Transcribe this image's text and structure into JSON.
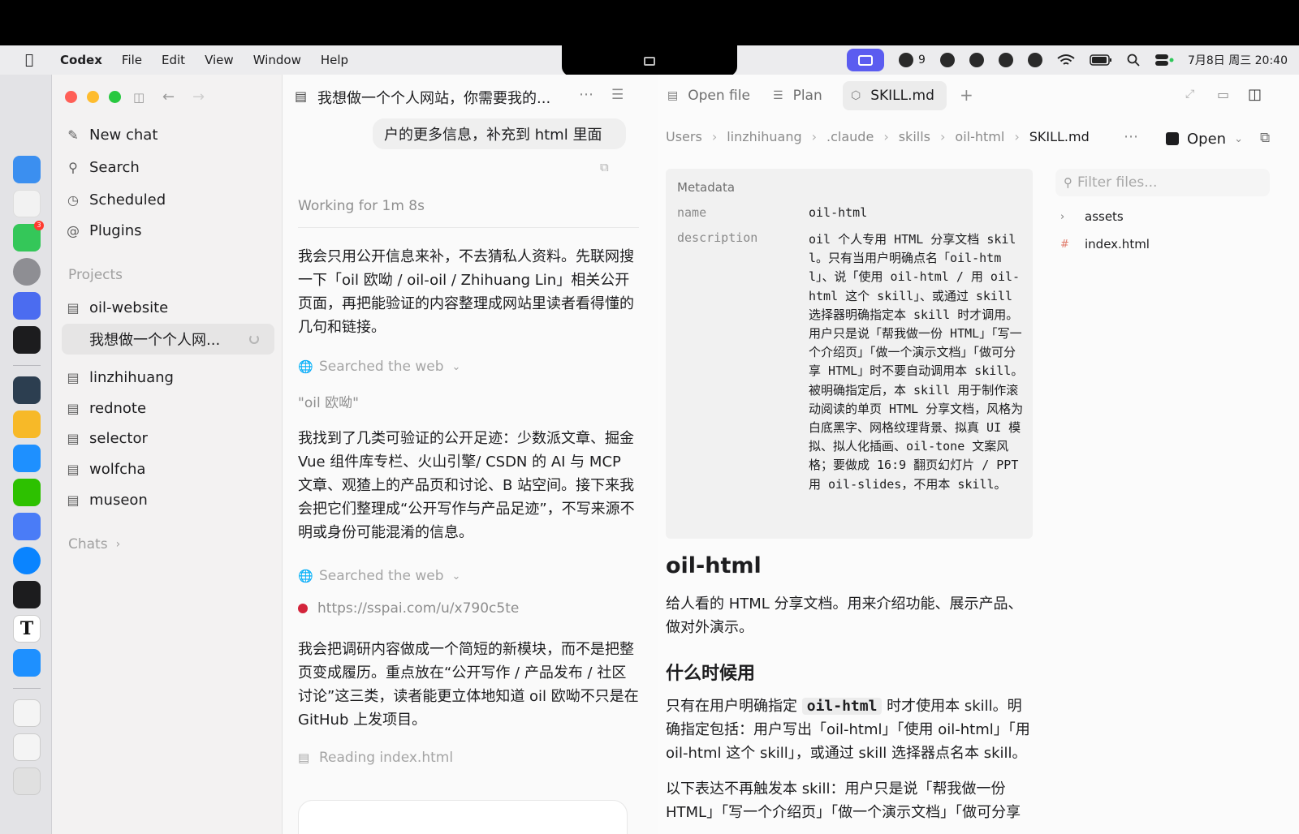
{
  "menubar": {
    "app": "Codex",
    "menus": [
      "File",
      "Edit",
      "View",
      "Window",
      "Help"
    ],
    "wechat_count": "9",
    "clock": "7月8日 周三 20:40"
  },
  "sidebar": {
    "new_chat": "New chat",
    "search": "Search",
    "scheduled": "Scheduled",
    "plugins": "Plugins",
    "projects_heading": "Projects",
    "project_main": "oil-website",
    "active_thread": "我想做一个个人网...",
    "projects": [
      "linzhihuang",
      "rednote",
      "selector",
      "wolfcha",
      "museon"
    ],
    "chats_heading": "Chats"
  },
  "chat": {
    "title": "我想做一个个人网站，你需要我的...",
    "bubble": "户的更多信息，补充到 html 里面",
    "working": "Working for 1m 8s",
    "para1": "我会只用公开信息来补，不去猜私人资料。先联网搜一下「oil 欧呦 / oil-oil / Zhihuang Lin」相关公开页面，再把能验证的内容整理成网站里读者看得懂的几句和链接。",
    "searched1": "Searched the web",
    "query1": "\"oil 欧呦\"",
    "para2": "我找到了几类可验证的公开足迹：少数派文章、掘金 Vue 组件库专栏、火山引擎/ CSDN 的 AI 与 MCP 文章、观猹上的产品页和讨论、B 站空间。接下来我会把它们整理成“公开写作与产品足迹”，不写来源不明或身份可能混淆的信息。",
    "searched2": "Searched the web",
    "link": "https://sspai.com/u/x790c5te",
    "para3": "我会把调研内容做成一个简短的新模块，而不是把整页变成履历。重点放在“公开写作 / 产品发布 / 社区讨论”这三类，读者能更立体地知道 oil 欧呦不只是在 GitHub 上发项目。",
    "reading": "Reading index.html"
  },
  "pane": {
    "tabs": [
      "Open file",
      "Plan",
      "SKILL.md"
    ],
    "breadcrumb": [
      "Users",
      "linzhihuang",
      ".claude",
      "skills",
      "oil-html",
      "SKILL.md"
    ],
    "open_label": "Open",
    "metadata": {
      "heading": "Metadata",
      "name_key": "name",
      "name_value": "oil-html",
      "desc_key": "description",
      "desc_value": "oil 个人专用 HTML 分享文档 skill。只有当用户明确点名「oil-html」、说「使用 oil-html / 用 oil-html 这个 skill」、或通过 skill 选择器明确指定本 skill 时才调用。用户只是说「帮我做一份 HTML」「写一个介绍页」「做一个演示文档」「做可分享 HTML」时不要自动调用本 skill。被明确指定后，本 skill 用于制作滚动阅读的单页 HTML 分享文档，风格为白底黑字、网格纹理背景、拟真 UI 模拟、拟人化插画、oil-tone 文案风格；要做成 16:9 翻页幻灯片 / PPT 用 oil-slides，不用本 skill。"
    },
    "doc": {
      "h1": "oil-html",
      "intro": "给人看的 HTML 分享文档。用来介绍功能、展示产品、做对外演示。",
      "h2": "什么时候用",
      "p1_a": "只有在用户明确指定 ",
      "p1_code": "oil-html",
      "p1_b": " 时才使用本 skill。明确指定包括：用户写出「oil-html」「使用 oil-html」「用 oil-html 这个 skill」，或通过 skill 选择器点名本 skill。",
      "p2": "以下表达不再触发本 skill：用户只是说「帮我做一份 HTML」「写一个介绍页」「做一个演示文档」「做可分享"
    },
    "files": {
      "filter_placeholder": "Filter files...",
      "items": [
        "assets",
        "index.html"
      ]
    }
  }
}
